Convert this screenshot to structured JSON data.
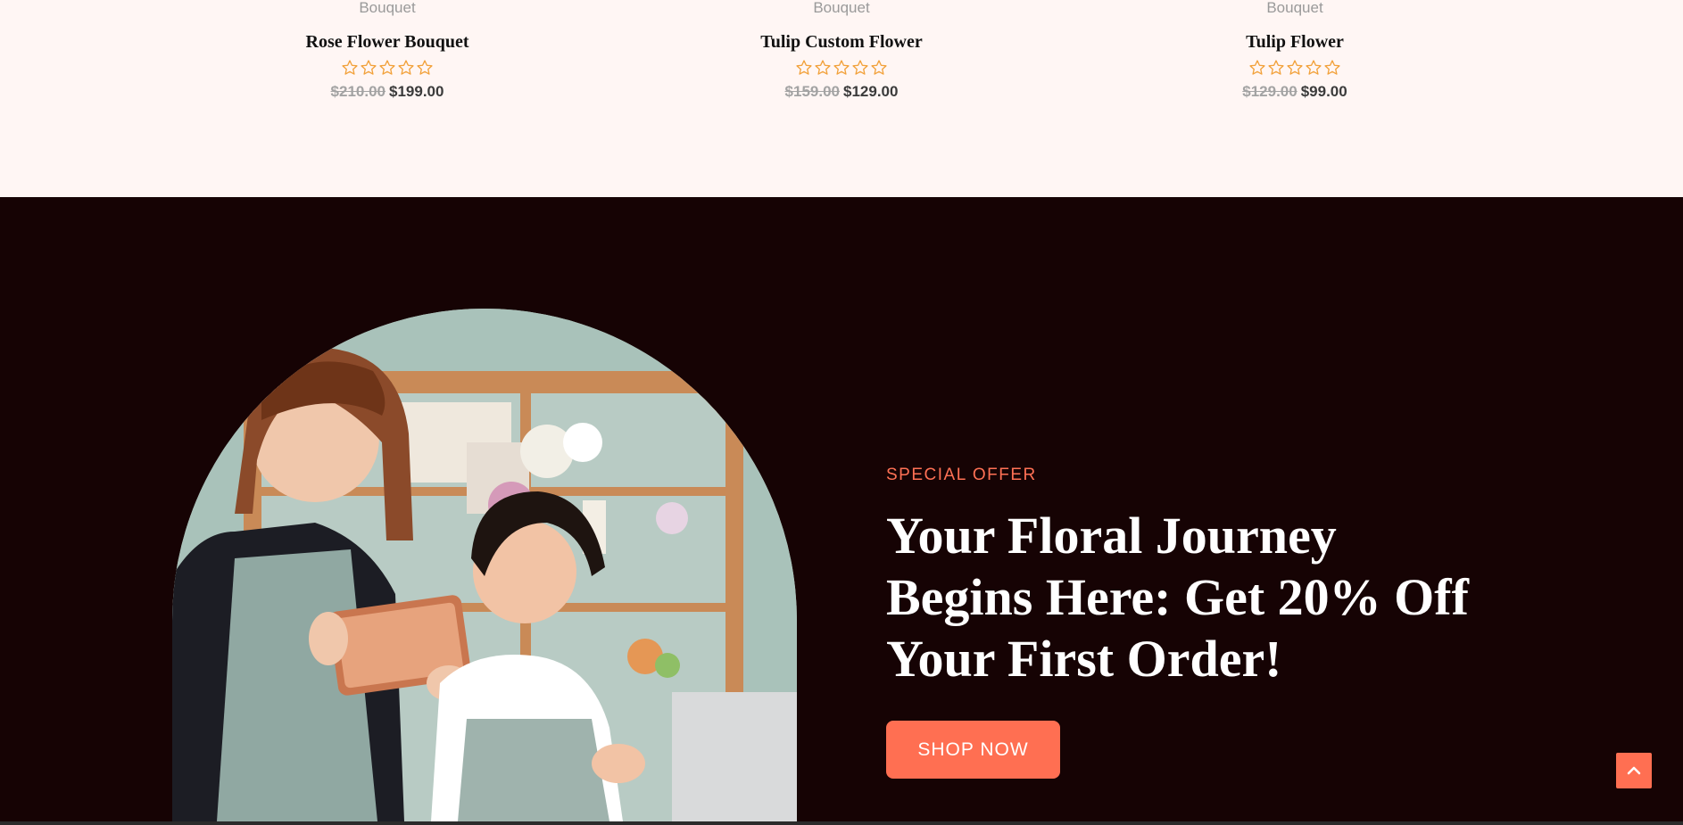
{
  "products": [
    {
      "category": "Bouquet",
      "title": "Rose Flower Bouquet",
      "old_price": "$210.00",
      "new_price": "$199.00",
      "rating": 0
    },
    {
      "category": "Bouquet",
      "title": "Tulip Custom Flower",
      "old_price": "$159.00",
      "new_price": "$129.00",
      "rating": 0
    },
    {
      "category": "Bouquet",
      "title": "Tulip Flower",
      "old_price": "$129.00",
      "new_price": "$99.00",
      "rating": 0
    }
  ],
  "promo": {
    "eyebrow": "SPECIAL OFFER",
    "headline_line1": "Your Floral Journey",
    "headline_line2": "Begins Here: Get 20% Off",
    "headline_line3": "Your First Order!",
    "button_label": "SHOP NOW"
  },
  "icons": {
    "star": "star-outline-icon",
    "scroll_top": "chevron-up-icon"
  },
  "colors": {
    "accent": "#ff6f52",
    "dark_bg": "#160304",
    "light_bg": "#fff6f4",
    "star": "#f2a13a"
  }
}
